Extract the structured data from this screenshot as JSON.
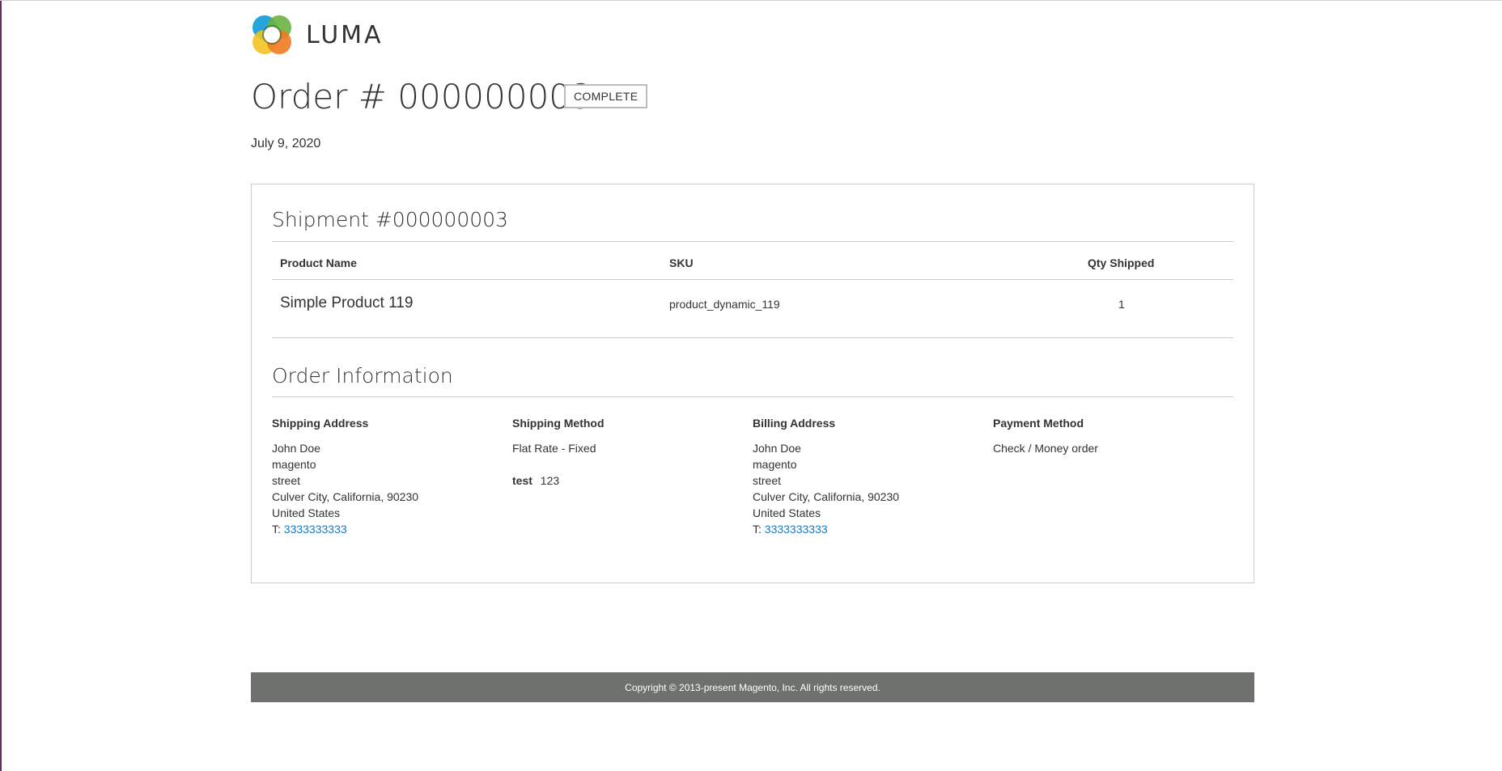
{
  "brand": {
    "logo_text": "LUMA",
    "logo_icon": "luma-logo-icon"
  },
  "order": {
    "title": "Order # 000000003",
    "status": "COMPLETE",
    "date": "July 9, 2020"
  },
  "shipment": {
    "title": "Shipment #000000003",
    "columns": {
      "product_name": "Product Name",
      "sku": "SKU",
      "qty": "Qty Shipped"
    },
    "items": [
      {
        "product_name": "Simple Product 119",
        "sku": "product_dynamic_119",
        "qty": "1"
      }
    ]
  },
  "order_information": {
    "title": "Order Information",
    "shipping_address": {
      "heading": "Shipping Address",
      "lines": [
        "John Doe",
        "magento",
        "street",
        "Culver City, California, 90230",
        "United States"
      ],
      "phone_prefix": "T:",
      "phone": "3333333333"
    },
    "shipping_method": {
      "heading": "Shipping Method",
      "method": "Flat Rate - Fixed",
      "tracking_label": "test",
      "tracking_number": "123"
    },
    "billing_address": {
      "heading": "Billing Address",
      "lines": [
        "John Doe",
        "magento",
        "street",
        "Culver City, California, 90230",
        "United States"
      ],
      "phone_prefix": "T:",
      "phone": "3333333333"
    },
    "payment_method": {
      "heading": "Payment Method",
      "method": "Check / Money order"
    }
  },
  "footer": {
    "copyright": "Copyright © 2013-present Magento, Inc. All rights reserved."
  },
  "colors": {
    "link": "#1979c3",
    "footer_bg": "#6e716e",
    "left_edge": "#6b2a5f"
  }
}
